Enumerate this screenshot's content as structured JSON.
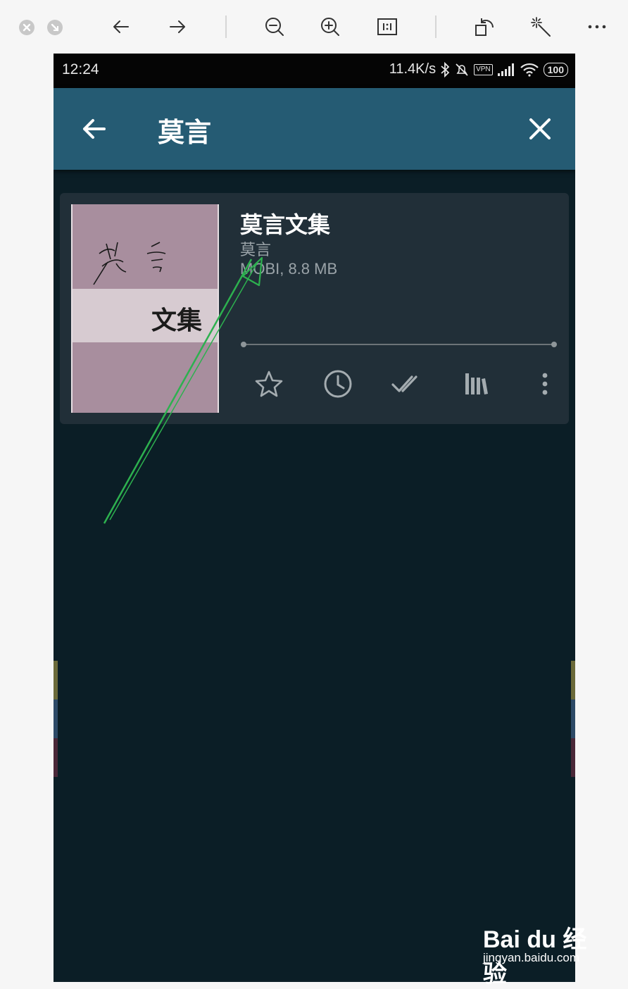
{
  "viewer": {
    "toolbar_icons": [
      "close-icon",
      "minimize-icon",
      "arrow-left-icon",
      "arrow-right-icon",
      "zoom-out-icon",
      "zoom-in-icon",
      "actual-size-icon",
      "rotate-icon",
      "magic-wand-icon",
      "more-icon"
    ]
  },
  "status_bar": {
    "time": "12:24",
    "net_speed": "11.4K/s",
    "vpn": "VPN",
    "battery": "100"
  },
  "app_bar": {
    "title": "莫言"
  },
  "book": {
    "cover_title": "文集",
    "cover_signature": "莫 言",
    "title": "莫言文集",
    "author": "莫言",
    "meta": "MOBI, 8.8 MB",
    "progress": 0
  },
  "actions": [
    "star-icon",
    "clock-icon",
    "double-check-icon",
    "library-icon",
    "more-vert-icon"
  ],
  "watermark": {
    "logo": "Bai du 经验",
    "url": "jingyan.baidu.com"
  },
  "colors": {
    "app_bar": "#255b73",
    "background": "#0b1e26",
    "card": "#212f38",
    "cover": "#a88e9e",
    "arrow": "#2db14f"
  }
}
